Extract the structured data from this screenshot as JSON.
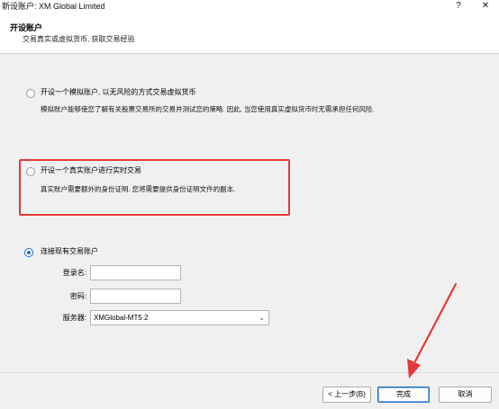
{
  "window": {
    "title": "新设账户: XM Global Limited",
    "help_glyph": "?",
    "close_glyph": "✕"
  },
  "header": {
    "title": "开设账户",
    "subtitle": "交易真实或虚拟货币, 获取交易经验"
  },
  "options": [
    {
      "label": "开设一个模拟账户, 以无风险的方式交易虚拟货币",
      "description": "模拟账户能够使您了解有关股票交易所的交易并测试您的策略. 因此, 当您使用真实虚拟货币时无需承担任何风险.",
      "selected": false
    },
    {
      "label": "开设一个真实账户进行实时交易",
      "description": "真实账户需要额外的身份证明. 您将需要提供身份证明文件的副本.",
      "selected": false
    },
    {
      "label": "连接现有交易账户",
      "selected": true
    }
  ],
  "login_form": {
    "login_label": "登录名:",
    "login_value": "",
    "password_label": "密码:",
    "password_value": "",
    "server_label": "服务器:",
    "server_value": "XMGlobal-MT5 2"
  },
  "buttons": {
    "back": "< 上一步(B)",
    "finish": "完成",
    "cancel": "取消"
  },
  "colors": {
    "accent": "#1b6fc2",
    "annotation_red": "#e5393a"
  },
  "icons": {
    "dropdown": "chevron-down-icon",
    "annotation": "red-arrow-annotation"
  }
}
